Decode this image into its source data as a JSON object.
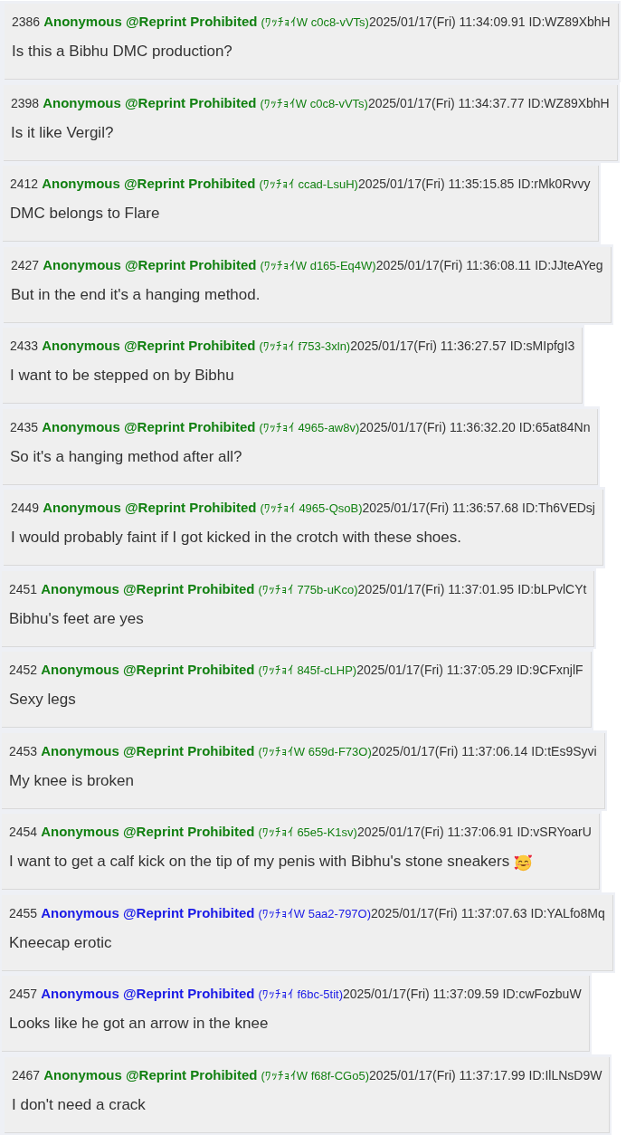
{
  "posts": [
    {
      "number": "2386",
      "name": "Anonymous @Reprint Prohibited",
      "trip": "(ﾜｯﾁｮｲW c0c8-vVTs)",
      "date": "2025/01/17(Fri) 11:34:09.91",
      "id": "ID:WZ89XbhH",
      "body": "Is this a Bibhu DMC production?",
      "color": "#118011",
      "emoji": false
    },
    {
      "number": "2398",
      "name": "Anonymous @Reprint Prohibited",
      "trip": "(ﾜｯﾁｮｲW c0c8-vVTs)",
      "date": "2025/01/17(Fri) 11:34:37.77",
      "id": "ID:WZ89XbhH",
      "body": "Is it like Vergil?",
      "color": "#118011",
      "emoji": false
    },
    {
      "number": "2412",
      "name": "Anonymous @Reprint Prohibited",
      "trip": "(ﾜｯﾁｮｲ ccad-LsuH)",
      "date": "2025/01/17(Fri) 11:35:15.85",
      "id": "ID:rMk0Rvvy",
      "body": "DMC belongs to Flare",
      "color": "#118011",
      "emoji": false
    },
    {
      "number": "2427",
      "name": "Anonymous @Reprint Prohibited",
      "trip": "(ﾜｯﾁｮｲW d165-Eq4W)",
      "date": "2025/01/17(Fri) 11:36:08.11",
      "id": "ID:JJteAYeg",
      "body": "But in the end it's a hanging method.",
      "color": "#118011",
      "emoji": false
    },
    {
      "number": "2433",
      "name": "Anonymous @Reprint Prohibited",
      "trip": "(ﾜｯﾁｮｲ f753-3xln)",
      "date": "2025/01/17(Fri) 11:36:27.57",
      "id": "ID:sMIpfgI3",
      "body": "I want to be stepped on by Bibhu",
      "color": "#118011",
      "emoji": false
    },
    {
      "number": "2435",
      "name": "Anonymous @Reprint Prohibited",
      "trip": "(ﾜｯﾁｮｲ 4965-aw8v)",
      "date": "2025/01/17(Fri) 11:36:32.20",
      "id": "ID:65at84Nn",
      "body": "So it's a hanging method after all?",
      "color": "#118011",
      "emoji": false
    },
    {
      "number": "2449",
      "name": "Anonymous @Reprint Prohibited",
      "trip": "(ﾜｯﾁｮｲ 4965-QsoB)",
      "date": "2025/01/17(Fri) 11:36:57.68",
      "id": "ID:Th6VEDsj",
      "body": "I would probably faint if I got kicked in the crotch with these shoes.",
      "color": "#118011",
      "emoji": false
    },
    {
      "number": "2451",
      "name": "Anonymous @Reprint Prohibited",
      "trip": "(ﾜｯﾁｮｲ 775b-uKco)",
      "date": "2025/01/17(Fri) 11:37:01.95",
      "id": "ID:bLPvlCYt",
      "body": "Bibhu's feet are yes",
      "color": "#118011",
      "emoji": false
    },
    {
      "number": "2452",
      "name": "Anonymous @Reprint Prohibited",
      "trip": "(ﾜｯﾁｮｲ 845f-cLHP)",
      "date": "2025/01/17(Fri) 11:37:05.29",
      "id": "ID:9CFxnjlF",
      "body": "Sexy legs",
      "color": "#118011",
      "emoji": false
    },
    {
      "number": "2453",
      "name": "Anonymous @Reprint Prohibited",
      "trip": "(ﾜｯﾁｮｲW 659d-F73O)",
      "date": "2025/01/17(Fri) 11:37:06.14",
      "id": "ID:tEs9Syvi",
      "body": "My knee is broken",
      "color": "#118011",
      "emoji": false
    },
    {
      "number": "2454",
      "name": "Anonymous @Reprint Prohibited",
      "trip": "(ﾜｯﾁｮｲ 65e5-K1sv)",
      "date": "2025/01/17(Fri) 11:37:06.91",
      "id": "ID:vSRYoarU",
      "body": "I want to get a calf kick on the tip of my penis with Bibhu's stone sneakers",
      "color": "#118011",
      "emoji": true
    },
    {
      "number": "2455",
      "name": "Anonymous @Reprint Prohibited",
      "trip": "(ﾜｯﾁｮｲW 5aa2-797O)",
      "date": "2025/01/17(Fri) 11:37:07.63",
      "id": "ID:YALfo8Mq",
      "body": "Kneecap erotic",
      "color": "#1a1ae6",
      "emoji": false
    },
    {
      "number": "2457",
      "name": "Anonymous @Reprint Prohibited",
      "trip": "(ﾜｯﾁｮｲ f6bc-5tit)",
      "date": "2025/01/17(Fri) 11:37:09.59",
      "id": "ID:cwFozbuW",
      "body": "Looks like he got an arrow in the knee",
      "color": "#1a1ae6",
      "emoji": false
    },
    {
      "number": "2467",
      "name": "Anonymous @Reprint Prohibited",
      "trip": "(ﾜｯﾁｮｲW f68f-CGo5)",
      "date": "2025/01/17(Fri) 11:37:17.99",
      "id": "ID:IlLNsD9W",
      "body": "I don't need a crack",
      "color": "#118011",
      "emoji": false
    }
  ]
}
